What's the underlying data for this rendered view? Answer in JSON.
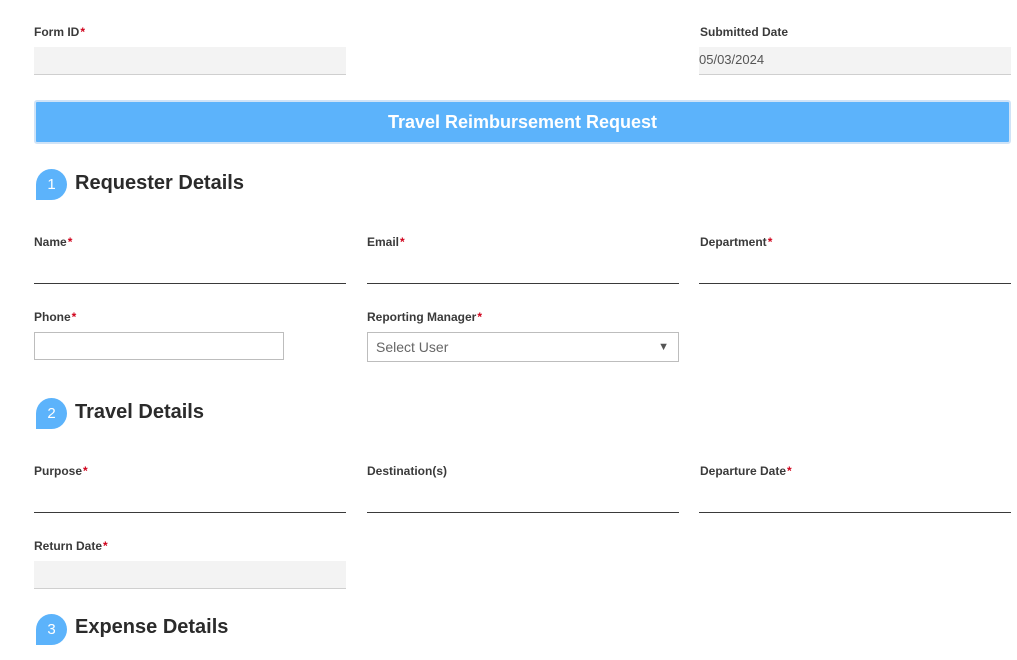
{
  "header": {
    "form_id_label": "Form ID",
    "form_id_value": "",
    "submitted_date_label": "Submitted Date",
    "submitted_date_value": "05/03/2024"
  },
  "banner": {
    "title": "Travel Reimbursement Request"
  },
  "sections": [
    {
      "number": "1",
      "title": "Requester Details"
    },
    {
      "number": "2",
      "title": "Travel Details"
    },
    {
      "number": "3",
      "title": "Expense Details"
    }
  ],
  "requester": {
    "name_label": "Name",
    "email_label": "Email",
    "department_label": "Department",
    "phone_label": "Phone",
    "manager_label": "Reporting Manager",
    "manager_placeholder": "Select User"
  },
  "travel": {
    "purpose_label": "Purpose",
    "destination_label": "Destination(s)",
    "departure_label": "Departure Date",
    "return_label": "Return Date"
  },
  "required_mark": "*",
  "colors": {
    "accent": "#5cb3fb",
    "required": "#d0021b"
  }
}
